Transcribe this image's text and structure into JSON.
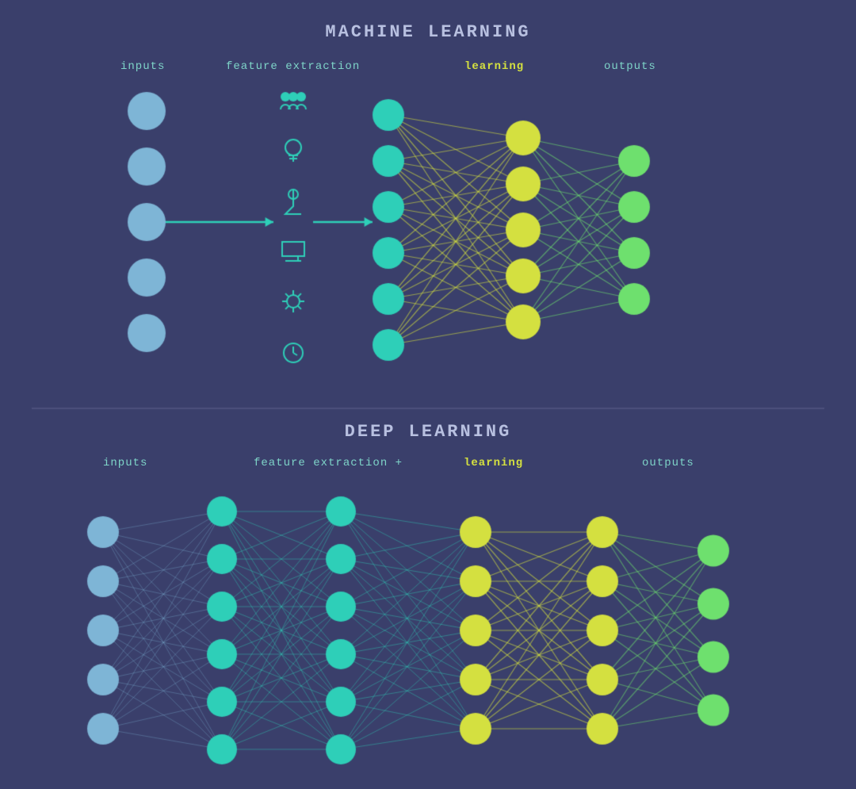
{
  "machine_learning": {
    "title": "MACHINE LEARNING",
    "labels": {
      "inputs": "inputs",
      "feature_extraction": "feature extraction",
      "learning": "learning",
      "outputs": "outputs"
    }
  },
  "deep_learning": {
    "title": "DEEP LEARNING",
    "labels": {
      "inputs": "inputs",
      "feature_extraction": "feature extraction + ",
      "learning": "learning",
      "outputs": "outputs"
    }
  },
  "colors": {
    "background": "#3a3f6b",
    "blue_node": "#7eb5d6",
    "teal_node": "#2ecfb8",
    "yellow_node": "#d4e040",
    "green_node": "#6ee06e",
    "connection_blue": "rgba(126,181,214,0.4)",
    "connection_teal": "rgba(46,207,184,0.5)",
    "connection_yellow": "rgba(212,224,64,0.7)",
    "connection_green": "rgba(110,224,110,0.5)",
    "arrow_teal": "#2ecfb8",
    "title_color": "#b8c0e0",
    "label_color": "#7ed4c8",
    "label_bold_color": "#d4e040"
  }
}
